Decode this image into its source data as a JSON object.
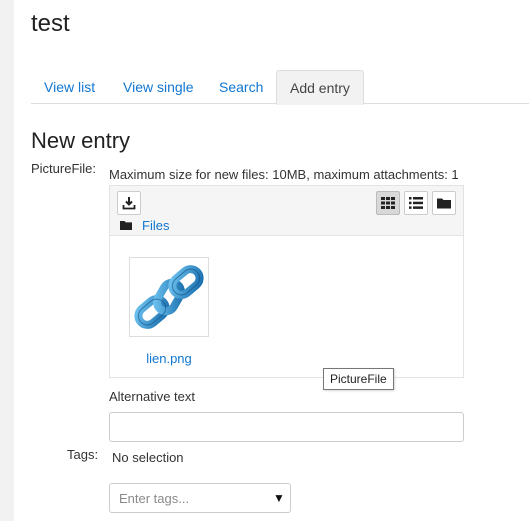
{
  "page": {
    "title": "test"
  },
  "tabs": [
    {
      "label": "View list"
    },
    {
      "label": "View single"
    },
    {
      "label": "Search"
    },
    {
      "label": "Add entry"
    }
  ],
  "section": {
    "title": "New entry"
  },
  "picture_field": {
    "label": "PictureFile:",
    "max_size_text": "Maximum size for new files: 10MB, maximum attachments: 1",
    "path_label": "Files",
    "file": {
      "name": "lien.png",
      "icon": "chain-link-image"
    },
    "tooltip": "PictureFile",
    "toolbar_icons": [
      "download-icon",
      "grid-view-icon",
      "list-view-icon",
      "folder-view-icon"
    ]
  },
  "alt_text": {
    "label": "Alternative text",
    "value": ""
  },
  "tags": {
    "label": "Tags:",
    "selection_text": "No selection",
    "placeholder": "Enter tags..."
  },
  "colors": {
    "link": "#1177d1",
    "border": "#dddddd",
    "toolbar_bg": "#f5f5f5",
    "chain": "#2f8fd0"
  }
}
